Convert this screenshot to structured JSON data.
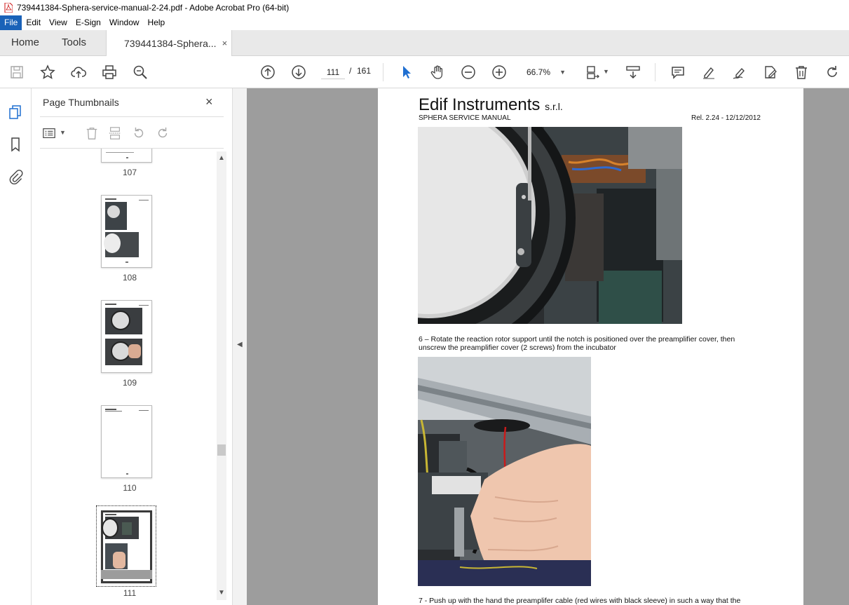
{
  "window": {
    "title": "739441384-Sphera-service-manual-2-24.pdf - Adobe Acrobat Pro (64-bit)"
  },
  "menu": [
    "File",
    "Edit",
    "View",
    "E-Sign",
    "Window",
    "Help"
  ],
  "tabs": {
    "home": "Home",
    "tools": "Tools",
    "document": "739441384-Sphera...",
    "close": "×"
  },
  "toolbar": {
    "current_page": "111",
    "separator": "/",
    "total_pages": "161",
    "zoom": "66.7%"
  },
  "panel": {
    "title": "Page Thumbnails",
    "close": "×"
  },
  "thumbnails": [
    {
      "label": "107"
    },
    {
      "label": "108"
    },
    {
      "label": "109"
    },
    {
      "label": "110"
    },
    {
      "label": "111"
    }
  ],
  "page": {
    "company": "Edif Instruments",
    "company_suffix": "s.r.l.",
    "manual": "SPHERA SERVICE MANUAL",
    "release": "Rel. 2.24 - 12/12/2012",
    "step6_line1": "6 – Rotate the reaction rotor support until the notch is positioned over the preamplifier cover, then",
    "step6_line2": "unscrew the preamplifier cover (2 screws) from the incubator",
    "step7_line1": "7 - Push up with the hand the preamplifer cable (red wires with black sleeve) in such a way that the"
  }
}
